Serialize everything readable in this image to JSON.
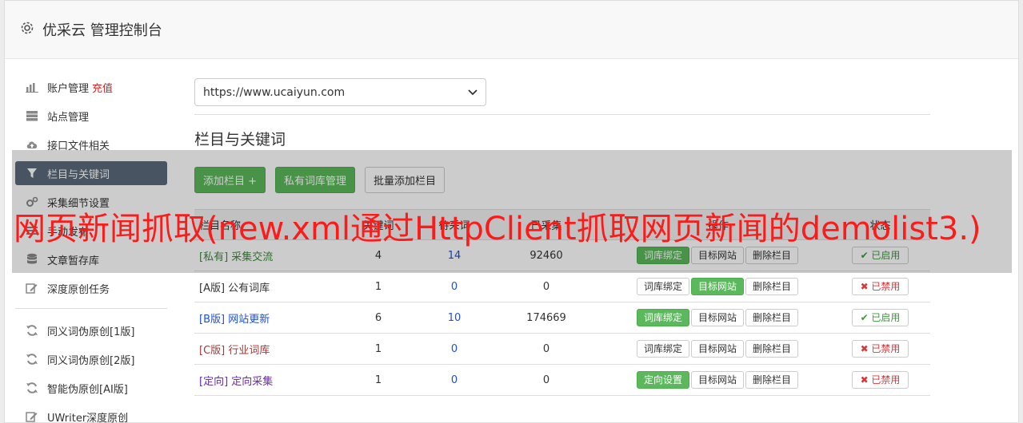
{
  "header": {
    "title": "优采云 管理控制台",
    "icon": "gear-icon"
  },
  "sidebar": {
    "items": [
      {
        "label": "账户管理",
        "extra": "充值",
        "icon": "bar-chart-icon",
        "active": false
      },
      {
        "label": "站点管理",
        "icon": "server-icon",
        "active": false
      },
      {
        "label": "接口文件相关",
        "icon": "cloud-upload-icon",
        "active": false
      },
      {
        "label": "栏目与关键词",
        "icon": "filter-icon",
        "active": true
      },
      {
        "label": "采集细节设置",
        "icon": "cogs-icon",
        "active": false
      },
      {
        "label": "手动发布",
        "icon": "list-icon",
        "active": false
      },
      {
        "label": "文章暂存库",
        "icon": "database-icon",
        "active": false
      },
      {
        "label": "深度原创任务",
        "icon": "edit-icon",
        "active": false
      }
    ],
    "items2": [
      {
        "label": "同义词伪原创[1版]",
        "icon": "refresh-icon"
      },
      {
        "label": "同义词伪原创[2版]",
        "icon": "refresh-icon"
      },
      {
        "label": "智能伪原创[AI版]",
        "icon": "refresh-icon"
      },
      {
        "label": "UWriter深度原创",
        "icon": "edit-icon"
      }
    ]
  },
  "main": {
    "site_select": "https://www.ucaiyun.com",
    "section_title": "栏目与关键词",
    "buttons": {
      "add": "添加栏目 +",
      "private_lib": "私有词库管理",
      "batch_add": "批量添加栏目"
    },
    "table": {
      "headers": [
        "栏目名称",
        "关键词",
        "待采词",
        "已采集",
        "操作",
        "状态"
      ],
      "rows": [
        {
          "tag": "[私有]",
          "name": "采集交流",
          "a": "4",
          "b": "14",
          "c": "92460",
          "op1": "词库绑定",
          "op2": "目标网站",
          "op3": "删除栏目",
          "status": "已启用",
          "on": true,
          "color": "#3c8a3c"
        },
        {
          "tag": "[A版]",
          "name": "公有词库",
          "a": "1",
          "b": "0",
          "c": "0",
          "op1": "词库绑定",
          "op2": "目标网站",
          "op3": "删除栏目",
          "status": "已禁用",
          "on": false,
          "color": "#333333"
        },
        {
          "tag": "[B版]",
          "name": "网站更新",
          "a": "6",
          "b": "10",
          "c": "174669",
          "op1": "词库绑定",
          "op2": "目标网站",
          "op3": "删除栏目",
          "status": "已启用",
          "on": true,
          "color": "#1f4fd6"
        },
        {
          "tag": "[C版]",
          "name": "行业词库",
          "a": "1",
          "b": "0",
          "c": "0",
          "op1": "词库绑定",
          "op2": "目标网站",
          "op3": "删除栏目",
          "status": "已禁用",
          "on": false,
          "color": "#a33a3a"
        },
        {
          "tag": "[定向]",
          "name": "定向采集",
          "a": "1",
          "b": "0",
          "c": "0",
          "op1": "定向设置",
          "op2": "目标网站",
          "op3": "删除栏目",
          "status": "已禁用",
          "on": false,
          "color": "#6a2bb5"
        }
      ]
    }
  },
  "watermark": "网页新闻抓取(new.xml通过HttpClient抓取网页新闻的demolist3.)"
}
